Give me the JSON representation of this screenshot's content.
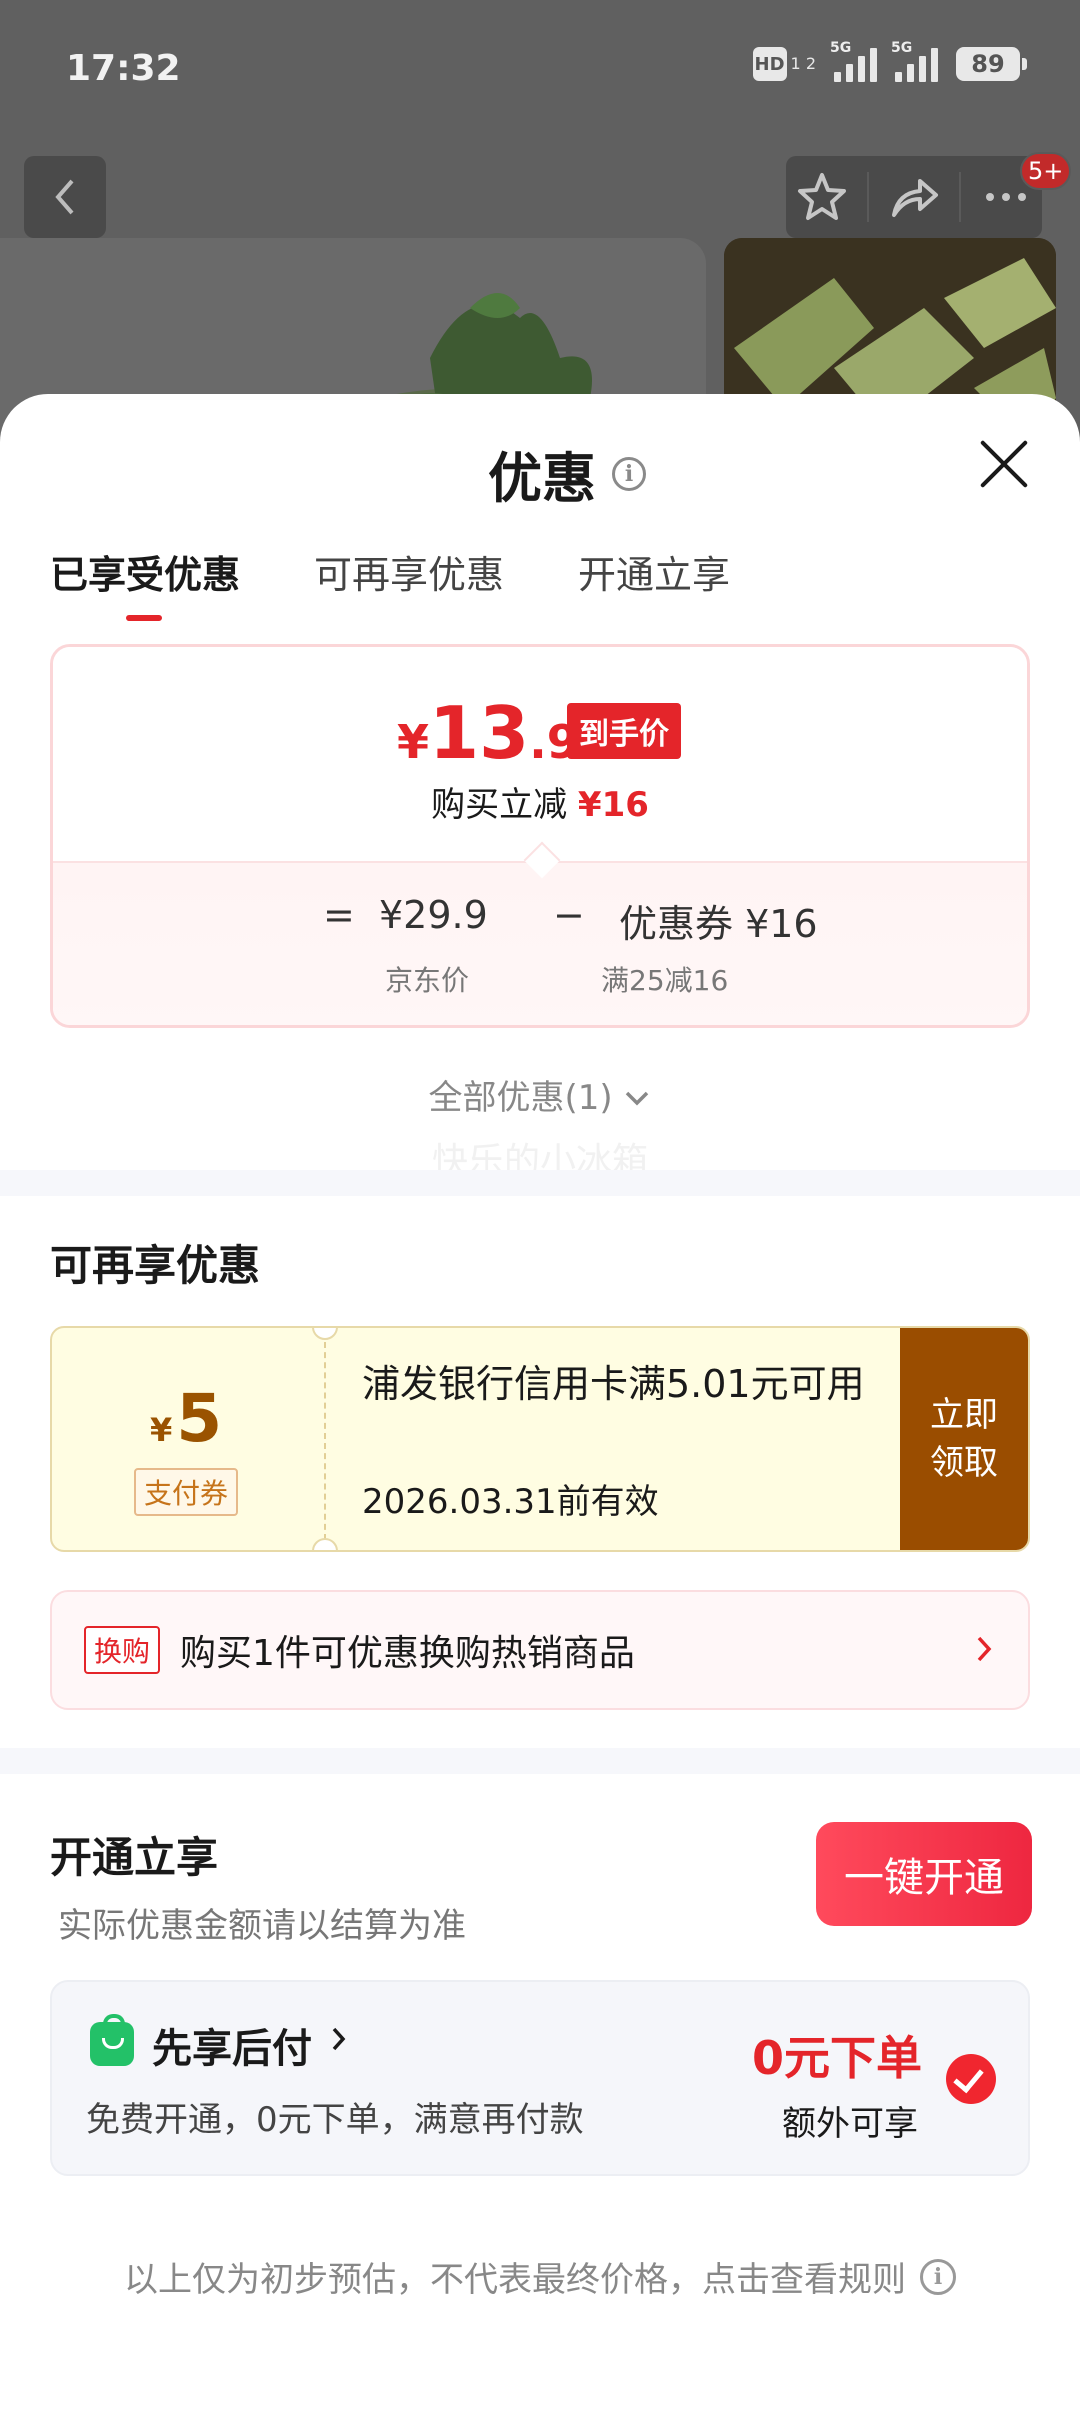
{
  "status_bar": {
    "time": "17:32",
    "hd_label": "HD",
    "hd_sub": "1 2",
    "signal1_label": "5G",
    "signal2_label": "5G",
    "battery": "89"
  },
  "top_bar": {
    "badge": "5+"
  },
  "sheet": {
    "title": "优惠",
    "tabs": [
      "已享受优惠",
      "可再享优惠",
      "开通立享"
    ]
  },
  "price_card": {
    "currency": "¥",
    "price_int": "13",
    "price_dec": ".9",
    "hand_price_tag": "到手价",
    "reduce_label": "购买立减",
    "reduce_amount": "¥16",
    "equals": "=",
    "jd_price": "¥29.9",
    "minus": "−",
    "coupon_label": "优惠券 ¥16",
    "jd_price_label": "京东价",
    "coupon_rule": "满25减16"
  },
  "all_discounts": "全部优惠(1)",
  "watermark": "快乐的小冰箱",
  "more_section": {
    "title": "可再享优惠",
    "coupon": {
      "currency": "¥",
      "amount": "5",
      "tag": "支付券",
      "description": "浦发银行信用卡满5.01元可用",
      "validity": "2026.03.31前有效",
      "claim_button": "立即领取"
    },
    "swap": {
      "tag": "换购",
      "text": "购买1件可优惠换购热销商品"
    }
  },
  "open_section": {
    "title": "开通立享",
    "subtitle": "实际优惠金额请以结算为准",
    "open_button": "一键开通",
    "pay_later": {
      "title": "先享后付",
      "description": "免费开通，0元下单，满意再付款",
      "highlight": "0元下单",
      "extra": "额外可享"
    }
  },
  "footer_note": "以上仅为初步预估，不代表最终价格，点击查看规则",
  "colors": {
    "accent_red": "#e4252a",
    "coupon_brown": "#9a4d00",
    "green": "#23c168"
  }
}
